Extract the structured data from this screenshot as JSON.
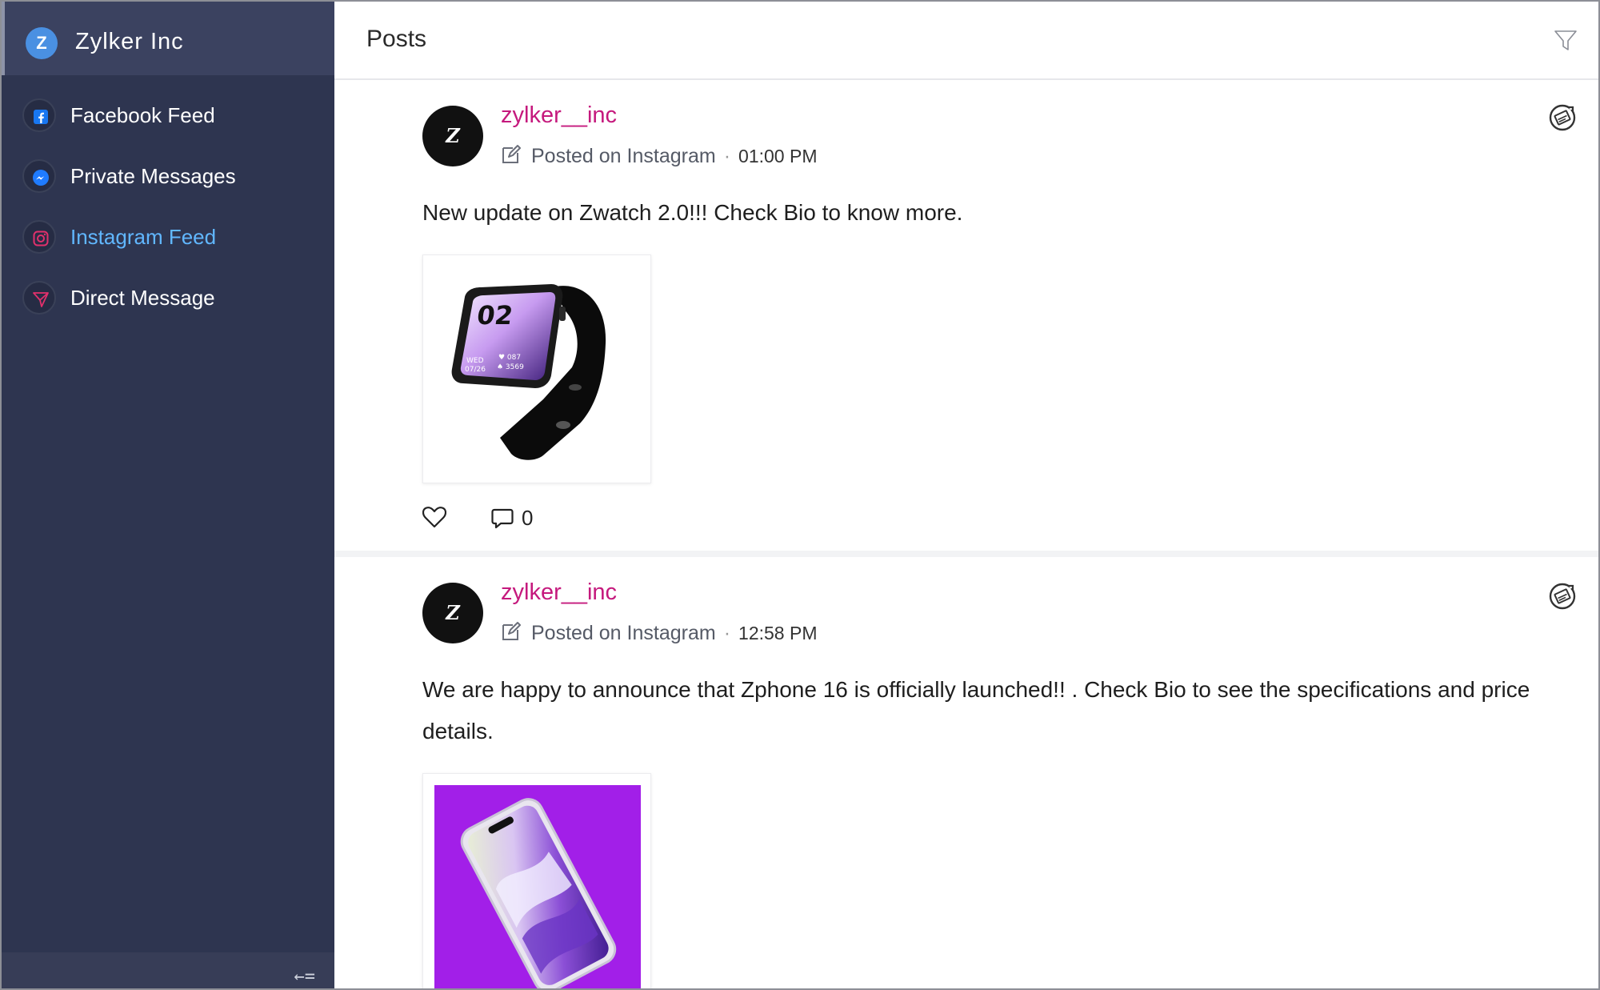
{
  "org": {
    "initial": "Z",
    "name": "Zylker Inc"
  },
  "nav": {
    "items": [
      {
        "label": "Facebook Feed",
        "icon": "facebook-icon",
        "active": false
      },
      {
        "label": "Private Messages",
        "icon": "messenger-icon",
        "active": false
      },
      {
        "label": "Instagram Feed",
        "icon": "instagram-icon",
        "active": true
      },
      {
        "label": "Direct Message",
        "icon": "direct-message-icon",
        "active": false
      }
    ],
    "collapse_icon": "collapse-sidebar-icon"
  },
  "header": {
    "title": "Posts",
    "filter_icon": "filter-icon"
  },
  "posts": [
    {
      "avatar_text": "Z",
      "author": "zylker__inc",
      "platform_text": "Posted on Instagram",
      "time": "01:00 PM",
      "text": "New update on Zwatch 2.0!!! Check Bio to know more.",
      "media": "smartwatch-image",
      "comments": "0"
    },
    {
      "avatar_text": "Z",
      "author": "zylker__inc",
      "platform_text": "Posted on Instagram",
      "time": "12:58 PM",
      "text": "We are happy to announce that Zphone 16 is officially launched!! . Check Bio to see the specifications and price details.",
      "media": "smartphone-image"
    }
  ],
  "colors": {
    "sidebar_bg": "#2e3550",
    "active_nav": "#61b7ff",
    "author": "#c5197d",
    "phone_bg": "#a21fe8"
  }
}
